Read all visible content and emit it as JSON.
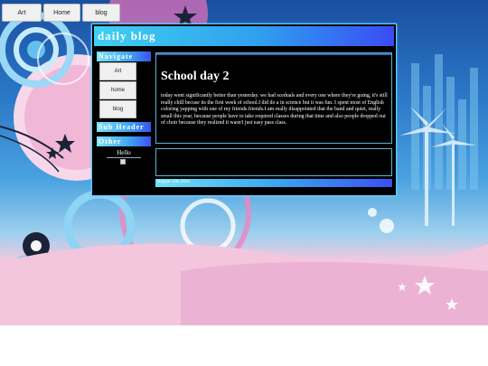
{
  "top_nav": {
    "art_label": "Art",
    "home_label": "Home",
    "blog_label": "blog"
  },
  "blog": {
    "title": "daily blog"
  },
  "sidebar": {
    "navigate_heading": "Navigate",
    "nav_items": [
      {
        "label": "Art"
      },
      {
        "label": "home"
      },
      {
        "label": "blog"
      }
    ],
    "sub_header_heading": "Sub Header",
    "other_heading": "Other",
    "hello_text": "Hello"
  },
  "post": {
    "title": "School day 2",
    "body": "today went significantly better than yesterday. we had sceduals and every one where they're going, it's still really chill becuse its the first week of school.I did do a in science but it was fun. I spent most of English coloring yapping with one of my friends.friends.I am really disappointed that the band and quiet, really small this year, because people have to take required classes during that time and also people dropped out of choir because they realized it wasn't just easy pass class.",
    "date": "August 12th 2024"
  },
  "colors": {
    "panel_bg": "#000000",
    "accent_cyan": "#3fd0f0",
    "accent_blue": "#3a4cf5",
    "background_pink": "#e9a9cf"
  }
}
